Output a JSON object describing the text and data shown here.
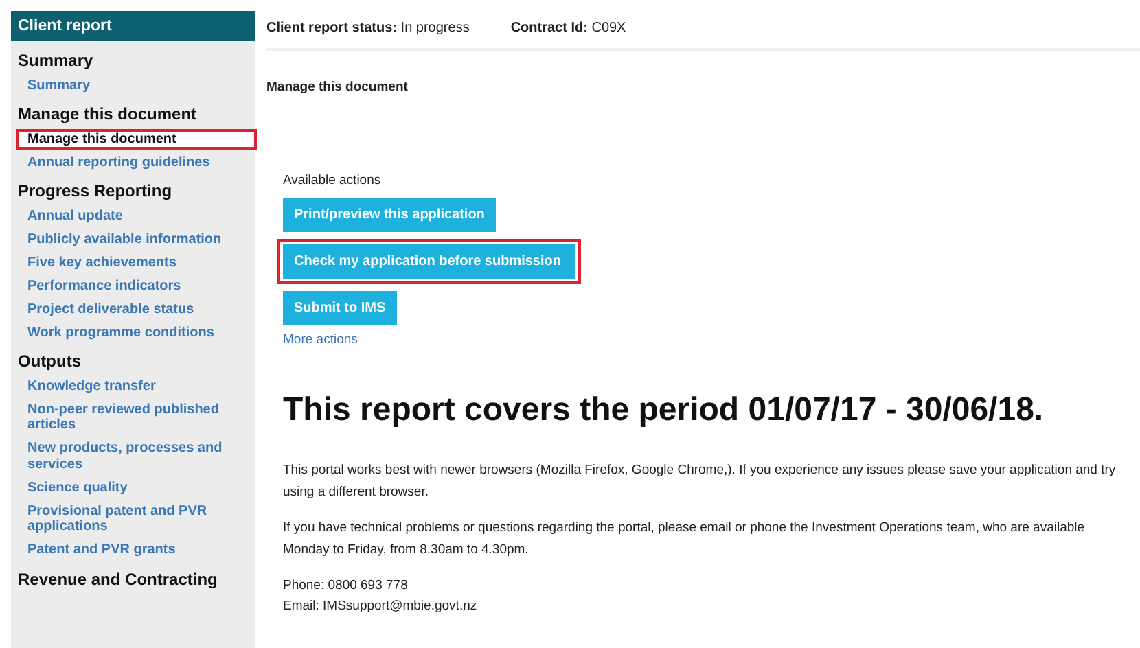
{
  "sidebar": {
    "title": "Client report",
    "sections": [
      {
        "heading": "Summary",
        "items": [
          {
            "label": "Summary",
            "selected": false,
            "highlighted": false
          }
        ]
      },
      {
        "heading": "Manage this document",
        "items": [
          {
            "label": "Manage this document",
            "selected": true,
            "highlighted": true
          },
          {
            "label": "Annual reporting guidelines",
            "selected": false,
            "highlighted": false
          }
        ]
      },
      {
        "heading": "Progress Reporting",
        "items": [
          {
            "label": "Annual update",
            "selected": false,
            "highlighted": false
          },
          {
            "label": "Publicly available information",
            "selected": false,
            "highlighted": false
          },
          {
            "label": "Five key achievements",
            "selected": false,
            "highlighted": false
          },
          {
            "label": "Performance indicators",
            "selected": false,
            "highlighted": false
          },
          {
            "label": "Project deliverable status",
            "selected": false,
            "highlighted": false
          },
          {
            "label": "Work programme conditions",
            "selected": false,
            "highlighted": false
          }
        ]
      },
      {
        "heading": "Outputs",
        "items": [
          {
            "label": "Knowledge transfer",
            "selected": false,
            "highlighted": false
          },
          {
            "label": "Non-peer reviewed published articles",
            "selected": false,
            "highlighted": false
          },
          {
            "label": "New products, processes and services",
            "selected": false,
            "highlighted": false
          },
          {
            "label": "Science quality",
            "selected": false,
            "highlighted": false
          },
          {
            "label": "Provisional patent and PVR applications",
            "selected": false,
            "highlighted": false
          },
          {
            "label": "Patent and PVR grants",
            "selected": false,
            "highlighted": false
          }
        ]
      },
      {
        "heading": "Revenue and Contracting"
      }
    ]
  },
  "status_bar": [
    {
      "label": "Client report status:",
      "value": "In progress"
    },
    {
      "label": "Contract Id:",
      "value": "C09X"
    }
  ],
  "page_title": "Manage this document",
  "actions": {
    "label": "Available actions",
    "buttons": [
      {
        "label": "Print/preview this application",
        "highlighted": false
      },
      {
        "label": "Check my application before submission",
        "highlighted": true
      },
      {
        "label": "Submit to IMS",
        "highlighted": false
      }
    ],
    "more": "More actions"
  },
  "heading": "This report covers the period 01/07/17 - 30/06/18.",
  "paragraphs": [
    "This portal works best with newer browsers (Mozilla Firefox, Google Chrome,). If you experience any issues please save your application and try using a different browser.",
    "If you have technical problems or questions regarding the portal, please email or phone the Investment Operations team, who are available Monday to Friday, from 8.30am to 4.30pm."
  ],
  "contact": [
    "Phone: 0800 693 778",
    "Email: IMSsupport@mbie.govt.nz"
  ]
}
